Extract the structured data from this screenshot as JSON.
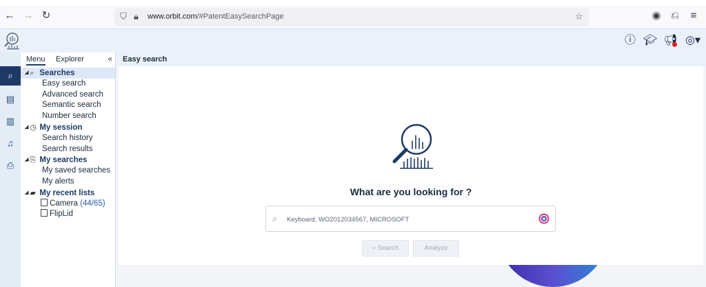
{
  "browser": {
    "url_host": "www.orbit.com",
    "url_path": "/#PatentEasySearchPage"
  },
  "sidebar": {
    "tabs": [
      "Menu",
      "Explorer"
    ],
    "collapse_label": "«",
    "groups": [
      {
        "label": "Searches",
        "items": [
          "Easy search",
          "Advanced search",
          "Semantic search",
          "Number search"
        ]
      },
      {
        "label": "My session",
        "items": [
          "Search history",
          "Search results"
        ]
      },
      {
        "label": "My searches",
        "items": [
          "My saved searches",
          "My alerts"
        ]
      },
      {
        "label": "My recent lists",
        "items": []
      }
    ],
    "recent_lists": [
      {
        "name": "Camera",
        "count": "(44/65)"
      },
      {
        "name": "FlipLid",
        "count": ""
      }
    ]
  },
  "main": {
    "header": "Easy search",
    "question": "What are you looking for ?",
    "search_placeholder": "Keyboard, WO2012034567, MICROSOFT",
    "search_button": "Search",
    "analyze_button": "Analyze"
  },
  "colors": {
    "accent": "#1d3a66",
    "header_bg": "#eaf1fa",
    "notification_dot": "#e02020"
  }
}
